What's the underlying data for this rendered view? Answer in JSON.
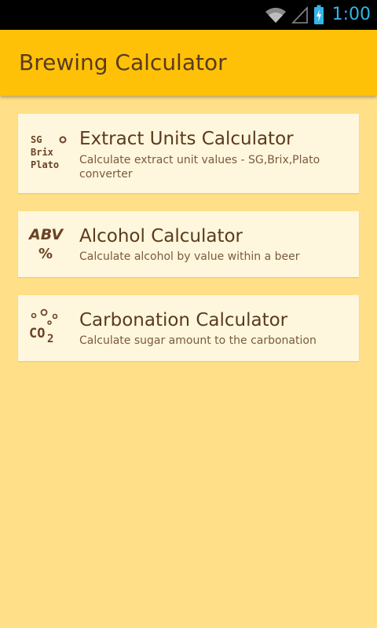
{
  "status_bar": {
    "time": "1:00",
    "icons": [
      "wifi-icon",
      "signal-icon",
      "battery-charging-icon"
    ],
    "clock_color": "#33b5e5"
  },
  "app_bar": {
    "title": "Brewing Calculator",
    "color": "#ffc107"
  },
  "background_color": "#ffe088",
  "cards": [
    {
      "title": "Extract Units Calculator",
      "subtitle": "Calculate extract unit values - SG,Brix,Plato converter",
      "icon": "sg-brix-plato-icon",
      "icon_text": [
        "SG",
        "Brix",
        "Plato"
      ]
    },
    {
      "title": "Alcohol Calculator",
      "subtitle": "Calculate alcohol by value within a beer",
      "icon": "abv-icon",
      "icon_text": [
        "ABV",
        "%"
      ]
    },
    {
      "title": "Carbonation Calculator",
      "subtitle": "Calculate sugar amount to the carbonation",
      "icon": "co2-icon",
      "icon_text": [
        "CO",
        "2"
      ]
    }
  ],
  "text_color": "#5a3a1e"
}
